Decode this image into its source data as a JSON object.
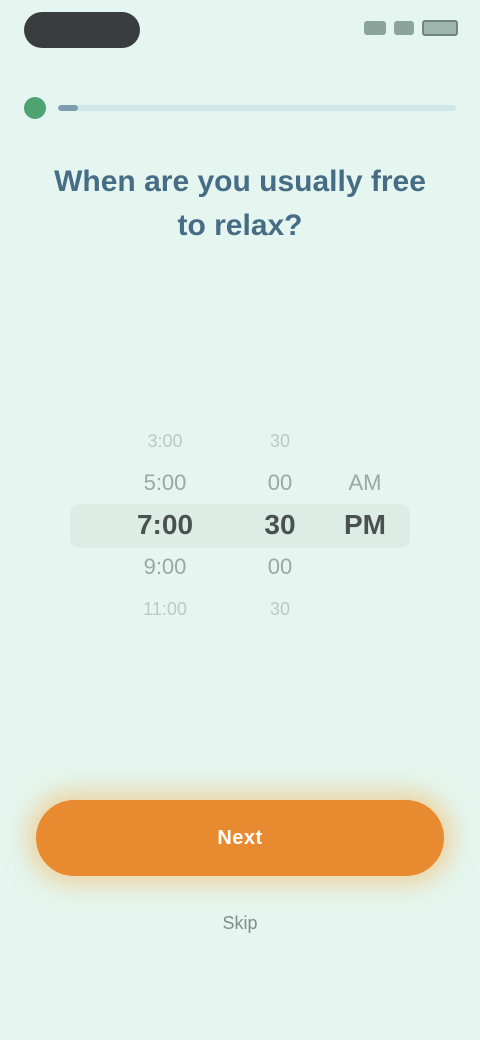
{
  "onboarding": {
    "progress": 0.05,
    "question": "When are you usually free to relax?",
    "time_picker": {
      "hours": [
        "3:00",
        "5:00",
        "7:00",
        "9:00",
        "11:00"
      ],
      "minutes": [
        "30",
        "00",
        "30",
        "00",
        "30"
      ],
      "periods": [
        "",
        "AM",
        "PM",
        "",
        ""
      ]
    },
    "next_label": "Next",
    "skip_label": "Skip"
  },
  "colors": {
    "background": "#e4f6ef",
    "accent": "#e88a2f",
    "progress_dot": "#4fa371",
    "title": "#466c86"
  }
}
